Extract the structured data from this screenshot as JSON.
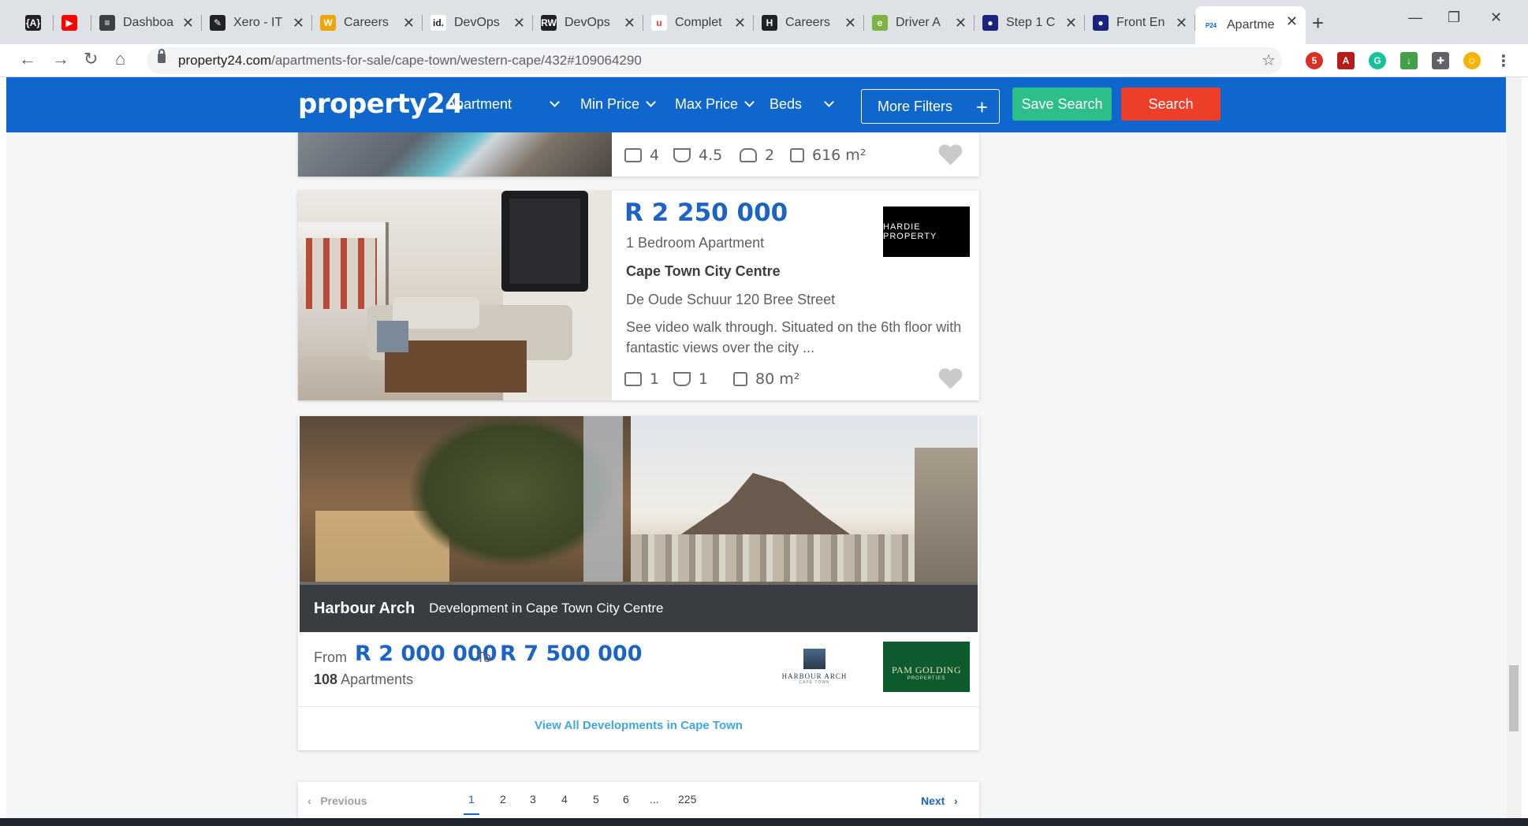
{
  "browser": {
    "tabs": [
      {
        "title": "",
        "favicon_color": "#202124",
        "favicon_glyph": "{A}"
      },
      {
        "title": "",
        "favicon_color": "#ff0000",
        "favicon_glyph": "▶"
      },
      {
        "title": "Dashboa",
        "favicon_color": "#3c4043",
        "favicon_glyph": "≡"
      },
      {
        "title": "Xero - IT",
        "favicon_color": "#202124",
        "favicon_glyph": "✎"
      },
      {
        "title": "Careers",
        "favicon_color": "#f0a500",
        "favicon_glyph": "W"
      },
      {
        "title": "DevOps",
        "favicon_color": "#ffffff",
        "favicon_glyph": "id."
      },
      {
        "title": "DevOps",
        "favicon_color": "#202124",
        "favicon_glyph": "RW"
      },
      {
        "title": "Complet",
        "favicon_color": "#ffffff",
        "favicon_glyph": "u"
      },
      {
        "title": "Careers",
        "favicon_color": "#202124",
        "favicon_glyph": "H"
      },
      {
        "title": "Driver A",
        "favicon_color": "#7cb342",
        "favicon_glyph": "e"
      },
      {
        "title": "Step 1 C",
        "favicon_color": "#1a237e",
        "favicon_glyph": "●"
      },
      {
        "title": "Front En",
        "favicon_color": "#1a237e",
        "favicon_glyph": "●"
      },
      {
        "title": "Apartme",
        "favicon_color": "#ffffff",
        "favicon_glyph": "P24"
      }
    ],
    "url_host": "property24.com",
    "url_path": "/apartments-for-sale/cape-town/western-cape/432#109064290"
  },
  "header": {
    "logo": "property24",
    "property_type": "Apartment",
    "min_price": "Min Price",
    "max_price": "Max Price",
    "beds": "Beds",
    "more_filters": "More Filters",
    "save_search": "Save Search",
    "search": "Search"
  },
  "listing_prev": {
    "beds": "4",
    "baths": "4.5",
    "parking": "2",
    "size": "616 m²"
  },
  "listing": {
    "price": "R 2 250 000",
    "type": "1 Bedroom Apartment",
    "location": "Cape Town City Centre",
    "address": "De Oude Schuur 120 Bree Street",
    "description": "See video walk through. Situated on the 6th floor with fantastic views over the city ...",
    "agency": "HARDIE PROPERTY",
    "beds": "1",
    "baths": "1",
    "size": "80 m²"
  },
  "development": {
    "name": "Harbour Arch",
    "subtitle": "Development in Cape Town City Centre",
    "from_label": "From",
    "price_from": "R 2 000 000",
    "to_label": "To",
    "price_to": "R 7 500 000",
    "unit_count": "108",
    "unit_label": "Apartments",
    "dev_logo": "HARBOUR ARCH",
    "dev_logo_sub": "CAPE TOWN",
    "agency": "PAM GOLDING",
    "agency_sub": "PROPERTIES",
    "view_all": "View All Developments in Cape Town"
  },
  "pagination": {
    "previous": "Previous",
    "next": "Next",
    "pages": [
      "1",
      "2",
      "3",
      "4",
      "5",
      "6",
      "...",
      "225"
    ],
    "current": "1"
  },
  "colors": {
    "brand_blue": "#0f66cc",
    "price_blue": "#1b64c4",
    "save_green": "#2dbf8a",
    "search_red": "#ee3e2a"
  }
}
